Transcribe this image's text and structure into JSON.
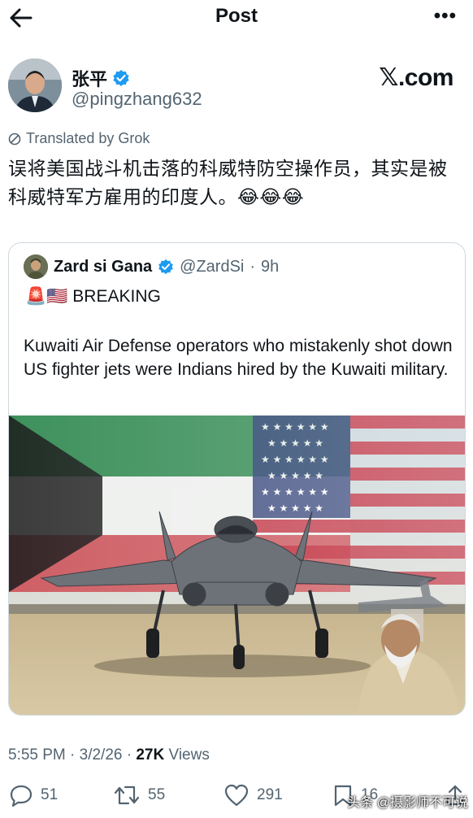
{
  "header": {
    "title": "Post"
  },
  "author": {
    "name": "张平",
    "handle": "@pingzhang632"
  },
  "brand": {
    "label": "𝕏.com"
  },
  "translated": {
    "label": "Translated by Grok"
  },
  "tweet": {
    "text": "误将美国战斗机击落的科威特防空操作员，其实是被科威特军方雇用的印度人。😂😂😂"
  },
  "quote": {
    "name": "Zard si Gana",
    "handle": "@ZardSi",
    "time": "9h",
    "flags": "🚨🇺🇸",
    "breaking": "BREAKING",
    "text": "Kuwaiti Air Defense operators who mistakenly shot down US fighter jets were Indians hired by the Kuwaiti military."
  },
  "meta": {
    "time": "5:55 PM · 3/2/26 · ",
    "views_count": "27K",
    "views_label": " Views"
  },
  "actions": {
    "replies": "51",
    "reposts": "55",
    "likes": "291",
    "bookmarks": "16"
  },
  "watermark": "头条 @摄影师不可说",
  "colors": {
    "verified": "#1d9bf0",
    "text": "#0f1419",
    "muted": "#536471",
    "border": "#cfd9de"
  }
}
